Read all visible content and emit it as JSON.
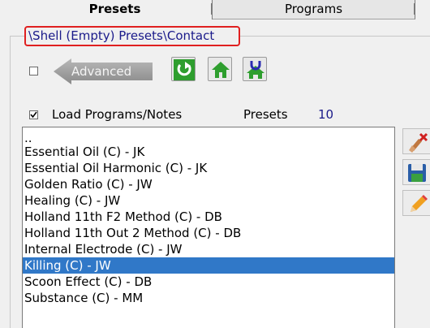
{
  "tabs": {
    "presets_label": "Presets",
    "programs_label": "Programs"
  },
  "path": {
    "text": "\\Shell (Empty) Presets\\Contact"
  },
  "advanced": {
    "label": "Advanced",
    "checked": false
  },
  "toolbar": {
    "refresh_icon": "refresh-icon",
    "home_icon": "home-icon",
    "home_magnet_icon": "home-magnet-icon"
  },
  "load": {
    "label": "Load Programs/Notes",
    "checked": true
  },
  "presets": {
    "label": "Presets",
    "count": "10"
  },
  "list": {
    "items": [
      {
        "label": ".."
      },
      {
        "label": "Essential Oil (C) - JK"
      },
      {
        "label": "Essential Oil Harmonic (C) - JK"
      },
      {
        "label": "Golden Ratio (C) - JW"
      },
      {
        "label": "Healing (C) - JW"
      },
      {
        "label": "Holland 11th F2 Method (C) - DB"
      },
      {
        "label": "Holland 11th Out 2 Method (C) - DB"
      },
      {
        "label": "Internal Electrode (C) - JW"
      },
      {
        "label": "Killing (C) - JW"
      },
      {
        "label": "Scoon Effect (C) - DB"
      },
      {
        "label": "Substance (C) - MM"
      }
    ],
    "selected_label": "Killing (C) - JW"
  },
  "colors": {
    "selection": "#3078c8",
    "highlight_border": "#e02020",
    "value_text": "#1a1a8a"
  }
}
